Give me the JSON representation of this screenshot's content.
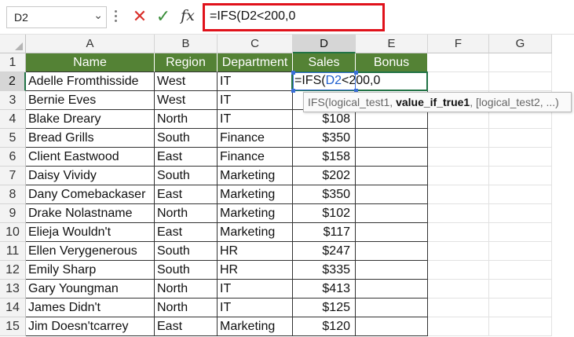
{
  "formula_bar": {
    "name_box": "D2",
    "cancel_glyph": "✕",
    "enter_glyph": "✓",
    "fx_label": "fx",
    "formula": "=IFS(D2<200,0"
  },
  "columns": [
    "A",
    "B",
    "C",
    "D",
    "E",
    "F",
    "G"
  ],
  "rows": [
    "1",
    "2",
    "3",
    "4",
    "5",
    "6",
    "7",
    "8",
    "9",
    "10",
    "11",
    "12",
    "13",
    "14",
    "15"
  ],
  "table": {
    "headers": [
      "Name",
      "Region",
      "Department",
      "Sales",
      "Bonus"
    ],
    "data": [
      [
        "Adelle Fromthisside",
        "West",
        "IT",
        "",
        ""
      ],
      [
        "Bernie Eves",
        "West",
        "IT",
        "",
        ""
      ],
      [
        "Blake Dreary",
        "North",
        "IT",
        "$108",
        ""
      ],
      [
        "Bread Grills",
        "South",
        "Finance",
        "$350",
        ""
      ],
      [
        "Client Eastwood",
        "East",
        "Finance",
        "$158",
        ""
      ],
      [
        "Daisy Vividy",
        "South",
        "Marketing",
        "$202",
        ""
      ],
      [
        "Dany Comebackaser",
        "East",
        "Marketing",
        "$350",
        ""
      ],
      [
        "Drake Nolastname",
        "North",
        "Marketing",
        "$102",
        ""
      ],
      [
        "Elieja Wouldn't",
        "East",
        "Marketing",
        "$117",
        ""
      ],
      [
        "Ellen Verygenerous",
        "South",
        "HR",
        "$247",
        ""
      ],
      [
        "Emily Sharp",
        "South",
        "HR",
        "$335",
        ""
      ],
      [
        "Gary Youngman",
        "North",
        "IT",
        "$413",
        ""
      ],
      [
        "James Didn't",
        "North",
        "IT",
        "$125",
        ""
      ],
      [
        "Jim Doesn'tcarrey",
        "East",
        "Marketing",
        "$120",
        ""
      ]
    ]
  },
  "active_cell": {
    "ref": "D2",
    "prefix": "=IFS(",
    "ref_text": "D2",
    "suffix": "<200,0"
  },
  "tooltip": {
    "func": "IFS(",
    "arg1": "logical_test1, ",
    "arg2_bold": "value_if_true1",
    "rest": ", [logical_test2, ...)"
  },
  "colors": {
    "header_fill": "#548235",
    "selection_green": "#217346",
    "formula_highlight": "#e0121b",
    "reference_blue": "#1f5fcf"
  }
}
